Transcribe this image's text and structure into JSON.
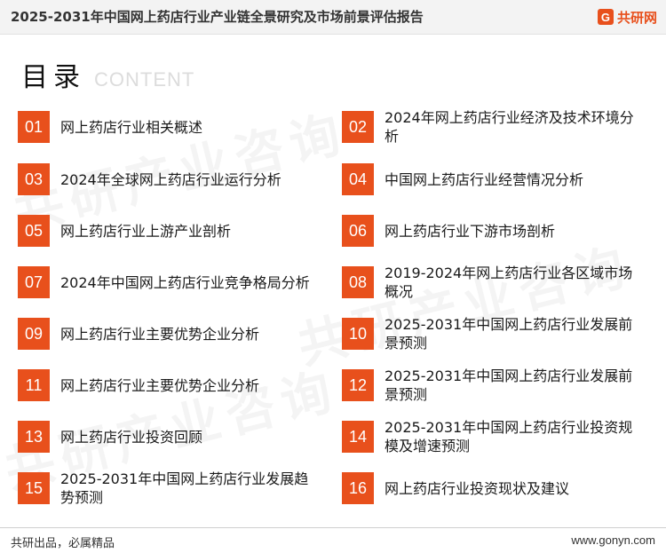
{
  "header": {
    "title": "2025-2031年中国网上药店行业产业链全景研究及市场前景评估报告",
    "logo_mark": "G",
    "logo_text": "共研网"
  },
  "toc": {
    "title": "目录",
    "subtitle": "CONTENT"
  },
  "watermark_text": "共研产业咨询",
  "items": [
    {
      "num": "01",
      "label": "网上药店行业相关概述"
    },
    {
      "num": "02",
      "label": "2024年网上药店行业经济及技术环境分析"
    },
    {
      "num": "03",
      "label": "2024年全球网上药店行业运行分析"
    },
    {
      "num": "04",
      "label": "中国网上药店行业经营情况分析"
    },
    {
      "num": "05",
      "label": "网上药店行业上游产业剖析"
    },
    {
      "num": "06",
      "label": "网上药店行业下游市场剖析"
    },
    {
      "num": "07",
      "label": "2024年中国网上药店行业竞争格局分析"
    },
    {
      "num": "08",
      "label": "2019-2024年网上药店行业各区域市场概况"
    },
    {
      "num": "09",
      "label": "网上药店行业主要优势企业分析"
    },
    {
      "num": "10",
      "label": "2025-2031年中国网上药店行业发展前景预测"
    },
    {
      "num": "11",
      "label": "网上药店行业主要优势企业分析"
    },
    {
      "num": "12",
      "label": "2025-2031年中国网上药店行业发展前景预测"
    },
    {
      "num": "13",
      "label": "网上药店行业投资回顾"
    },
    {
      "num": "14",
      "label": "2025-2031年中国网上药店行业投资规模及增速预测"
    },
    {
      "num": "15",
      "label": "2025-2031年中国网上药店行业发展趋势预测"
    },
    {
      "num": "16",
      "label": "网上药店行业投资现状及建议"
    }
  ],
  "footer": {
    "left": "共研出品，必属精品",
    "right": "www.gonyn.com"
  },
  "colors": {
    "accent": "#e8501c"
  }
}
